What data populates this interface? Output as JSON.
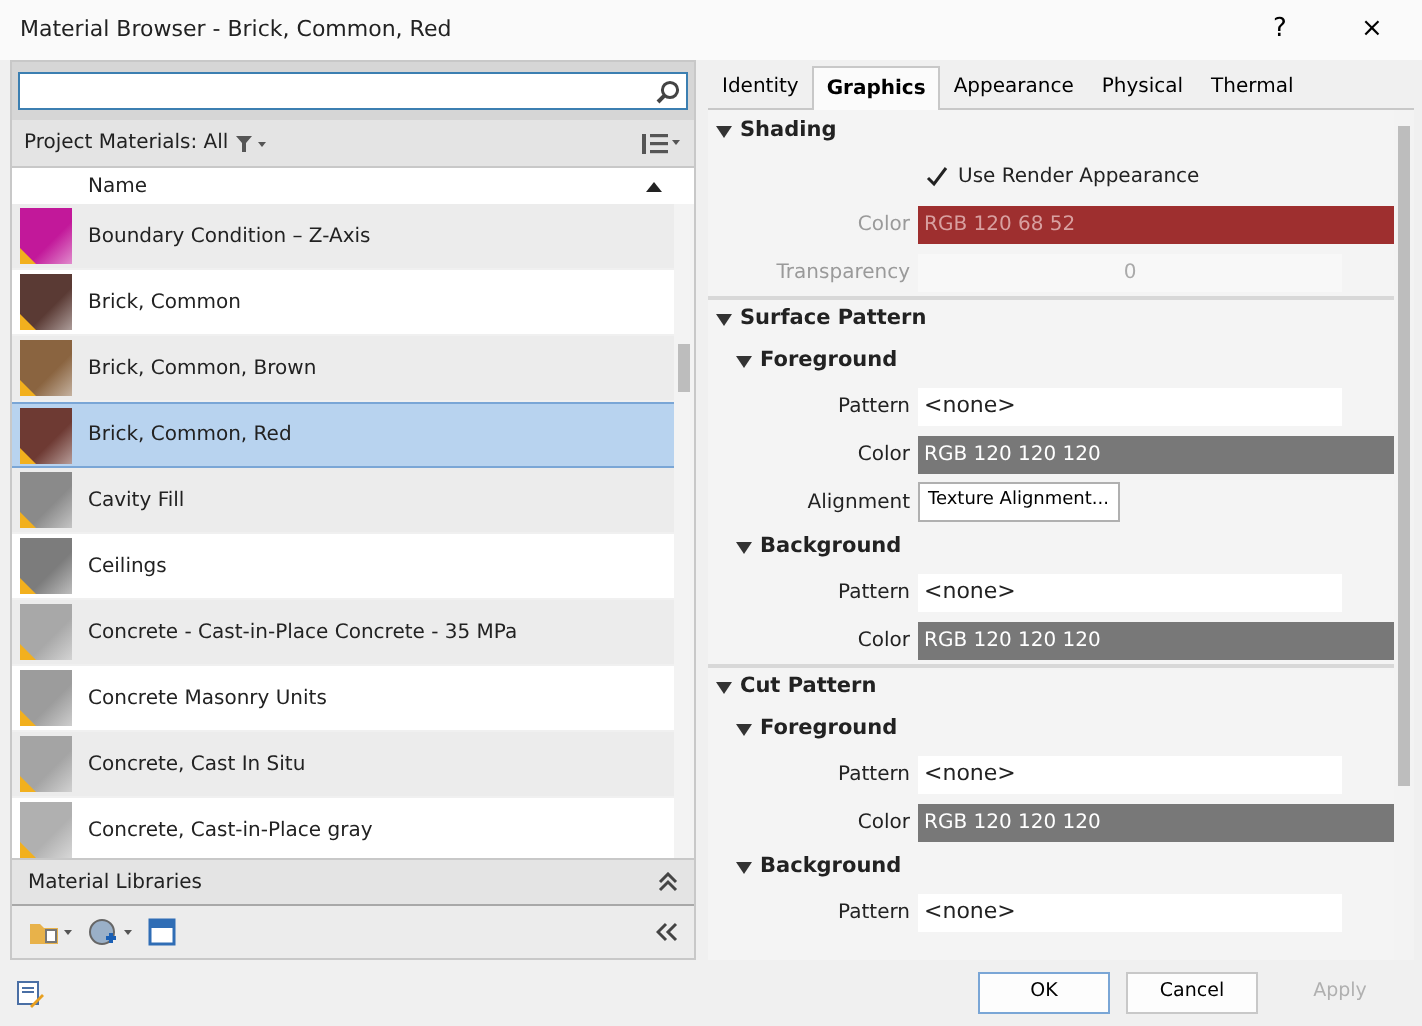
{
  "window": {
    "title": "Material Browser - Brick, Common, Red",
    "help": "?",
    "close": "×"
  },
  "project": {
    "filter_label": "Project Materials: All",
    "column": "Name",
    "materials": [
      {
        "name": "Boundary Condition – Z-Axis",
        "color": "#c2189a",
        "selected": false
      },
      {
        "name": "Brick, Common",
        "color": "#5a3a34",
        "selected": false
      },
      {
        "name": "Brick, Common, Brown",
        "color": "#8a6440",
        "selected": false
      },
      {
        "name": "Brick, Common, Red",
        "color": "#6e3a33",
        "selected": true
      },
      {
        "name": "Cavity Fill",
        "color": "#8a8a8a",
        "selected": false
      },
      {
        "name": "Ceilings",
        "color": "#7c7c7c",
        "selected": false
      },
      {
        "name": "Concrete - Cast-in-Place Concrete - 35 MPa",
        "color": "#a8a8a8",
        "selected": false
      },
      {
        "name": "Concrete Masonry Units",
        "color": "#9c9c9c",
        "selected": false
      },
      {
        "name": "Concrete, Cast In Situ",
        "color": "#a4a4a4",
        "selected": false
      },
      {
        "name": "Concrete, Cast-in-Place gray",
        "color": "#b0b0b0",
        "selected": false
      }
    ],
    "libraries": "Material Libraries"
  },
  "tabs": [
    {
      "label": "Identity",
      "selected": false
    },
    {
      "label": "Graphics",
      "selected": true
    },
    {
      "label": "Appearance",
      "selected": false
    },
    {
      "label": "Physical",
      "selected": false
    },
    {
      "label": "Thermal",
      "selected": false
    }
  ],
  "sections": [
    {
      "title": "Shading",
      "expanded": true,
      "rows": [
        {
          "kind": "check",
          "label": "Use Render Appearance",
          "checked": true
        },
        {
          "kind": "color",
          "label": "Color",
          "value": "RGB 120 68 52",
          "color": "#9e2f2f",
          "disabled": true
        },
        {
          "kind": "slider",
          "label": "Transparency",
          "value": "0",
          "disabled": true
        }
      ]
    },
    {
      "title": "Surface Pattern",
      "expanded": true,
      "groups": [
        {
          "title": "Foreground",
          "expanded": true,
          "rows": [
            {
              "kind": "text",
              "label": "Pattern",
              "value": "<none>"
            },
            {
              "kind": "color",
              "label": "Color",
              "value": "RGB 120 120 120",
              "color": "#787878",
              "disabled": false
            },
            {
              "kind": "button",
              "label": "Alignment",
              "value": "Texture Alignment..."
            }
          ]
        },
        {
          "title": "Background",
          "expanded": true,
          "rows": [
            {
              "kind": "text",
              "label": "Pattern",
              "value": "<none>"
            },
            {
              "kind": "color",
              "label": "Color",
              "value": "RGB 120 120 120",
              "color": "#787878",
              "disabled": false
            }
          ]
        }
      ]
    },
    {
      "title": "Cut Pattern",
      "expanded": true,
      "groups": [
        {
          "title": "Foreground",
          "expanded": true,
          "rows": [
            {
              "kind": "text",
              "label": "Pattern",
              "value": "<none>"
            },
            {
              "kind": "color",
              "label": "Color",
              "value": "RGB 120 120 120",
              "color": "#787878",
              "disabled": false
            }
          ]
        },
        {
          "title": "Background",
          "expanded": true,
          "rows": [
            {
              "kind": "text",
              "label": "Pattern",
              "value": "<none>"
            }
          ]
        }
      ]
    }
  ],
  "buttons": [
    {
      "label": "OK",
      "disabled": false,
      "default": true
    },
    {
      "label": "Cancel",
      "disabled": false,
      "default": false
    },
    {
      "label": "Apply",
      "disabled": true,
      "default": false
    }
  ]
}
